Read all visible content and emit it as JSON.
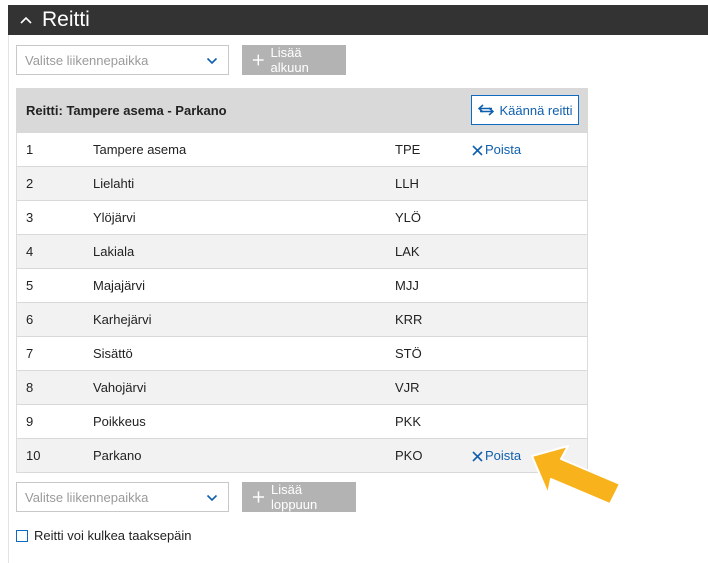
{
  "header": {
    "title": "Reitti"
  },
  "top_add": {
    "select_placeholder": "Valitse liikennepaikka",
    "button_label": "Lisää alkuun"
  },
  "route": {
    "title": "Reitti: Tampere asema - Parkano",
    "reverse_label": "Käännä reitti",
    "remove_label": "Poista",
    "stops": [
      {
        "index": "1",
        "name": "Tampere asema",
        "code": "TPE",
        "removable": true
      },
      {
        "index": "2",
        "name": "Lielahti",
        "code": "LLH",
        "removable": false
      },
      {
        "index": "3",
        "name": "Ylöjärvi",
        "code": "YLÖ",
        "removable": false
      },
      {
        "index": "4",
        "name": "Lakiala",
        "code": "LAK",
        "removable": false
      },
      {
        "index": "5",
        "name": "Majajärvi",
        "code": "MJJ",
        "removable": false
      },
      {
        "index": "6",
        "name": "Karhejärvi",
        "code": "KRR",
        "removable": false
      },
      {
        "index": "7",
        "name": "Sisättö",
        "code": "STÖ",
        "removable": false
      },
      {
        "index": "8",
        "name": "Vahojärvi",
        "code": "VJR",
        "removable": false
      },
      {
        "index": "9",
        "name": "Poikkeus",
        "code": "PKK",
        "removable": false
      },
      {
        "index": "10",
        "name": "Parkano",
        "code": "PKO",
        "removable": true
      }
    ]
  },
  "bottom_add": {
    "select_placeholder": "Valitse liikennepaikka",
    "button_label": "Lisää loppuun"
  },
  "backwards_checkbox": {
    "label": "Reitti voi kulkea taaksepäin",
    "checked": false
  },
  "colors": {
    "header_bg": "#333333",
    "accent": "#0f6ac0",
    "callout_arrow": "#f7b21c"
  }
}
